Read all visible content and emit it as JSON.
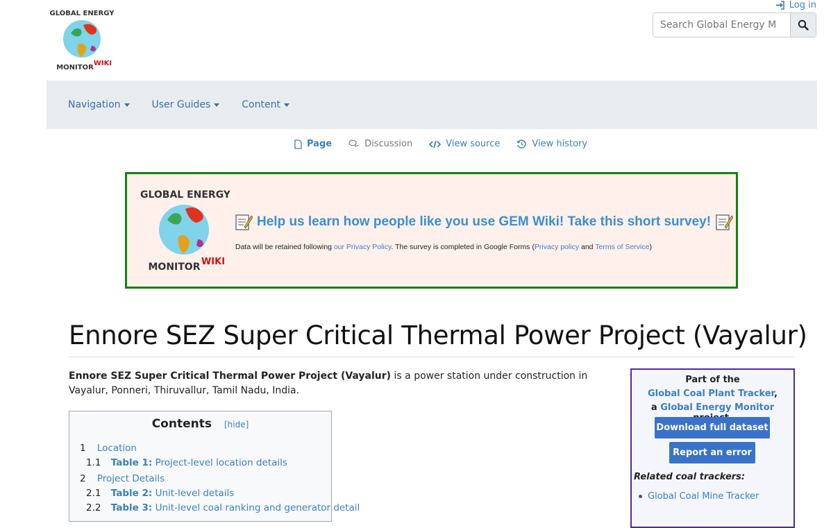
{
  "header": {
    "login_label": "Log in",
    "search_placeholder": "Search Global Energy M",
    "logo_text": "GLOBAL ENERGY MONITOR WIKI"
  },
  "nav": {
    "items": [
      {
        "label": "Navigation"
      },
      {
        "label": "User Guides"
      },
      {
        "label": "Content"
      }
    ]
  },
  "tabs": {
    "page": "Page",
    "discussion": "Discussion",
    "view_source": "View source",
    "view_history": "View history"
  },
  "banner": {
    "headline": "Help us learn how people like you use GEM Wiki! Take this short survey!",
    "note_prefix": "Data will be retained following ",
    "privacy_policy_link": "our Privacy Policy",
    "note_mid": ". The survey is completed in Google Forms (",
    "google_privacy_link": "Privacy policy",
    "note_and": " and ",
    "terms_link": "Terms of Service",
    "note_end": ")"
  },
  "article": {
    "title": "Ennore SEZ Super Critical Thermal Power Project (Vayalur)",
    "intro_bold": "Ennore SEZ Super Critical Thermal Power Project (Vayalur)",
    "intro_rest": " is a power station under construction in Vayalur, Ponneri, Thiruvallur, Tamil Nadu, India."
  },
  "toc": {
    "title": "Contents",
    "hide_label": "[hide]",
    "entries": [
      {
        "num": "1",
        "label": "Location",
        "bold": ""
      },
      {
        "num": "1.1",
        "label": "Project-level location details",
        "bold": "Table 1:"
      },
      {
        "num": "2",
        "label": "Project Details",
        "bold": ""
      },
      {
        "num": "2.1",
        "label": "Unit-level details",
        "bold": "Table 2:"
      },
      {
        "num": "2.2",
        "label": "Unit-level coal ranking and generator detail",
        "bold": "Table 3:"
      }
    ]
  },
  "sidebox": {
    "part_of": "Part of the",
    "tracker_link": "Global Coal Plant Tracker",
    "tracker_suffix": ",",
    "a_prefix": "a ",
    "gem_link": "Global Energy Monitor",
    "project_suffix": " project.",
    "download_label": "Download full dataset",
    "report_label": "Report an error",
    "related_title": "Related coal trackers:",
    "related_items": [
      "Global Coal Mine Tracker"
    ]
  },
  "colors": {
    "link": "#3a7fc1",
    "banner_border": "#118011",
    "banner_bg": "#fff0ec",
    "sidebox_border": "#4a2aa0",
    "button_bg": "#3a72c9"
  }
}
